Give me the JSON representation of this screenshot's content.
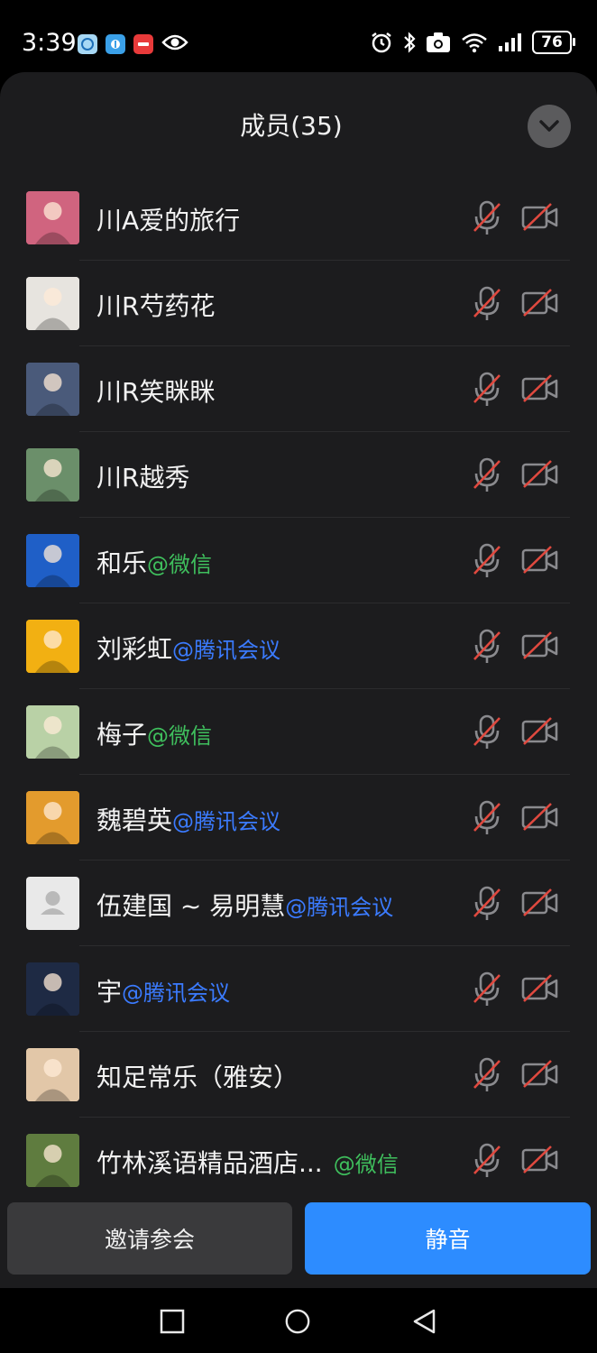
{
  "status": {
    "time": "3:39",
    "battery": "76",
    "apps": [
      {
        "icon": "chat-bubble-app-icon",
        "color": "#a7d8f5"
      },
      {
        "icon": "circle-app-icon",
        "color": "#3aa0e8"
      },
      {
        "icon": "huawei-app-icon",
        "color": "#e83a3a"
      },
      {
        "icon": "eye-icon",
        "color": "#ffffff"
      }
    ]
  },
  "sheet": {
    "title": "成员(35)"
  },
  "members": [
    {
      "name": "川A爱的旅行",
      "suffix": "",
      "suffix_type": "",
      "avatar": "woman-pink-photo",
      "avatar_bg": "#d0647f"
    },
    {
      "name": "川R芍药花",
      "suffix": "",
      "suffix_type": "",
      "avatar": "woman-portrait-photo",
      "avatar_bg": "#e7e4df"
    },
    {
      "name": "川R笑眯眯",
      "suffix": "",
      "suffix_type": "",
      "avatar": "night-lake-photo",
      "avatar_bg": "#4a5a7a"
    },
    {
      "name": "川R越秀",
      "suffix": "",
      "suffix_type": "",
      "avatar": "park-photo",
      "avatar_bg": "#6b8f6a"
    },
    {
      "name": "和乐",
      "suffix": "@微信",
      "suffix_type": "wx",
      "avatar": "blue-sky-cloud-photo",
      "avatar_bg": "#1f5fc7"
    },
    {
      "name": "刘彩虹",
      "suffix": "@腾讯会议",
      "suffix_type": "tm",
      "avatar": "sunflower-photo",
      "avatar_bg": "#f2b012"
    },
    {
      "name": "梅子",
      "suffix": "@微信",
      "suffix_type": "wx",
      "avatar": "woman-green-photo",
      "avatar_bg": "#b9d1a6"
    },
    {
      "name": "魏碧英",
      "suffix": "@腾讯会议",
      "suffix_type": "tm",
      "avatar": "sunset-jump-photo",
      "avatar_bg": "#e39b2d"
    },
    {
      "name": "伍建国 ~ 易明慧",
      "suffix": "@腾讯会议",
      "suffix_type": "tm",
      "avatar": "default-avatar",
      "avatar_bg": "#e9e9e9"
    },
    {
      "name": "宇",
      "suffix": "@腾讯会议",
      "suffix_type": "tm",
      "avatar": "dark-art-photo",
      "avatar_bg": "#1e2a44"
    },
    {
      "name": "知足常乐（雅安）",
      "suffix": "",
      "suffix_type": "",
      "avatar": "woman-smile-photo",
      "avatar_bg": "#e2c7a8"
    },
    {
      "name": "竹林溪语精品酒店...",
      "suffix": "@微信",
      "suffix_type": "wx",
      "avatar": "garden-photo",
      "avatar_bg": "#5f7c3f"
    }
  ],
  "actions": {
    "invite_label": "邀请参会",
    "mute_label": "静音"
  },
  "colors": {
    "accent": "#2d8cff",
    "wechat": "#3fbf5d",
    "tencent_meeting": "#3b7bff",
    "muted_icon_red": "#e0493f"
  }
}
